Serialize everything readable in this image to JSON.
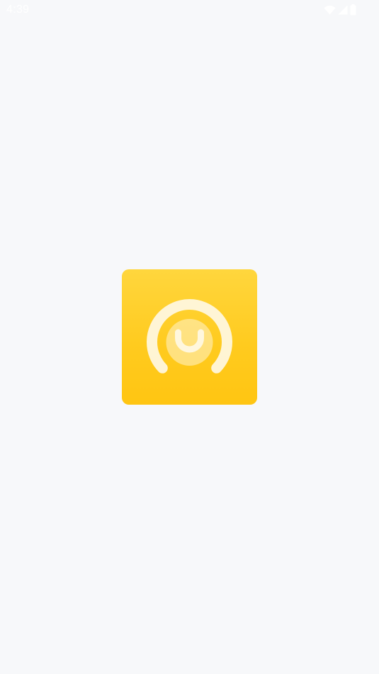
{
  "status_bar": {
    "time": "4:39",
    "icons": [
      "wifi-icon",
      "cellular-signal-icon",
      "battery-icon"
    ]
  },
  "splash": {
    "logo_icon": "app-logo-icon",
    "colors": {
      "logo_background_top": "#ffd63d",
      "logo_background_bottom": "#ffc512",
      "logo_mark": "#fff7de",
      "page_background": "#f7f8fa"
    }
  }
}
